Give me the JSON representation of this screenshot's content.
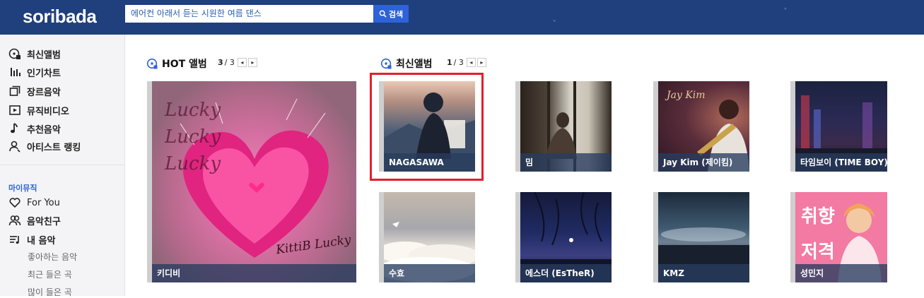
{
  "header": {
    "logo": "soribada",
    "search_placeholder": "에어컨 아래서 듣는 시원한 여름 댄스",
    "search_button": "검색"
  },
  "sidebar": {
    "items": [
      {
        "label": "최신앨범",
        "icon": "new-album-icon"
      },
      {
        "label": "인기차트",
        "icon": "chart-bars-icon"
      },
      {
        "label": "장르음악",
        "icon": "genre-icon"
      },
      {
        "label": "뮤직비디오",
        "icon": "video-play-icon"
      },
      {
        "label": "추천음악",
        "icon": "music-note-icon"
      },
      {
        "label": "아티스트 랭킹",
        "icon": "artist-icon"
      }
    ],
    "mymusic_title": "마이뮤직",
    "mymusic_items": [
      {
        "label": "For You",
        "icon": "heart-icon"
      },
      {
        "label": "음악친구",
        "icon": "friends-icon"
      },
      {
        "label": "내 음악",
        "icon": "playlist-icon"
      }
    ],
    "mymusic_sub": [
      "좋아하는 음악",
      "최근 들은 곡",
      "많이 들은 곡"
    ]
  },
  "hot": {
    "title": "HOT 앨범",
    "page_current": "3",
    "page_total": "/ 3",
    "album": {
      "name": "키디비",
      "art_text": "Lucky Lucky Lucky",
      "art_sub": "KittiB Lucky"
    }
  },
  "new": {
    "title": "최신앨범",
    "page_current": "1",
    "page_total": "/ 3",
    "albums": [
      {
        "name": "NAGASAWA"
      },
      {
        "name": "밈"
      },
      {
        "name": "Jay Kim (제이킴)",
        "art_text": "Jay Kim"
      },
      {
        "name": "타임보이 (TIME BOY)"
      },
      {
        "name": "수효"
      },
      {
        "name": "에스더 (EsTheR)"
      },
      {
        "name": "KMZ"
      },
      {
        "name": "성민지",
        "art_text": "취향 저격"
      }
    ]
  },
  "colors": {
    "header_bg": "#1f3f7d",
    "search_button": "#2e62d9",
    "highlight": "#e0202a",
    "mymusic_accent": "#2e62d9"
  }
}
